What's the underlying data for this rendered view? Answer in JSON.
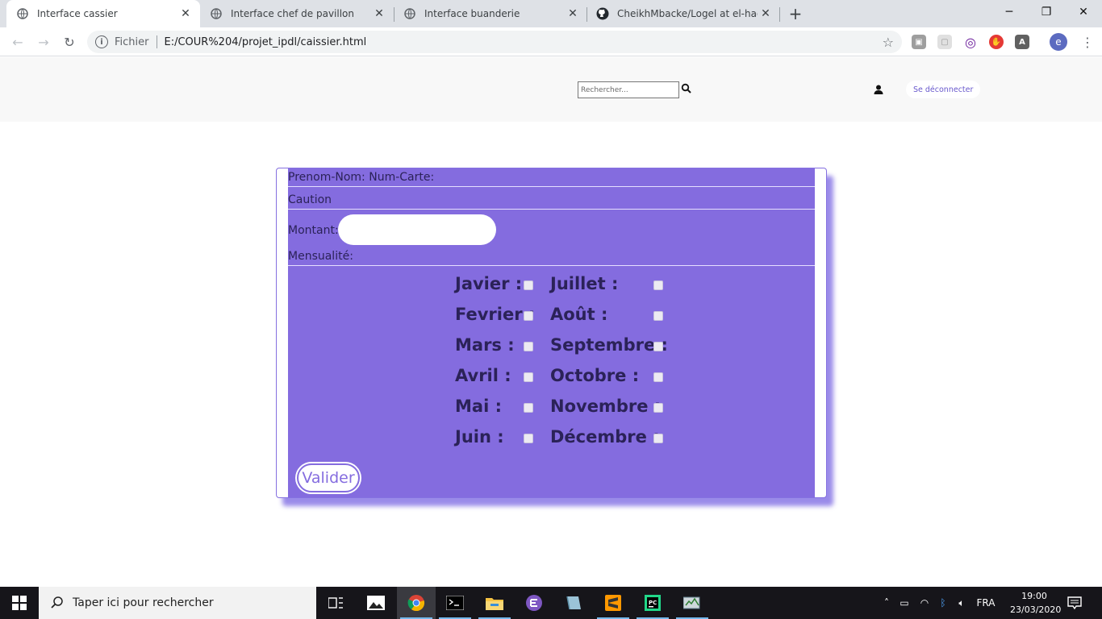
{
  "browser": {
    "tabs": [
      {
        "title": "Interface cassier",
        "active": true
      },
      {
        "title": "Interface chef de pavillon",
        "active": false
      },
      {
        "title": "Interface buanderie",
        "active": false
      },
      {
        "title": "CheikhMbacke/Logel at el-hadji",
        "active": false
      }
    ],
    "address": {
      "scheme": "Fichier",
      "url": "E:/COUR%204/projet_ipdl/caissier.html"
    },
    "profile_initial": "e"
  },
  "navbar": {
    "search_placeholder": "Rechercher...",
    "logout_label": "Se déconnecter"
  },
  "form": {
    "line1": "Prenom-Nom: Num-Carte:",
    "caution": "Caution",
    "montant_label": "Montant:",
    "mensualite_label": "Mensualité:",
    "months_left": [
      "Javier :",
      "Fevrier :",
      "Mars :",
      "Avril :",
      "Mai :",
      "Juin :"
    ],
    "months_right": [
      "Juillet :",
      "Août :",
      "Septembre :",
      "Octobre :",
      "Novembre :",
      "Décembre :"
    ],
    "submit_label": "Valider"
  },
  "taskbar": {
    "search_placeholder": "Taper ici pour rechercher",
    "language": "FRA",
    "time": "19:00",
    "date": "23/03/2020"
  },
  "colors": {
    "form_bg": "#846cdf",
    "form_text": "#2b2258",
    "accent": "#6a5acd"
  }
}
